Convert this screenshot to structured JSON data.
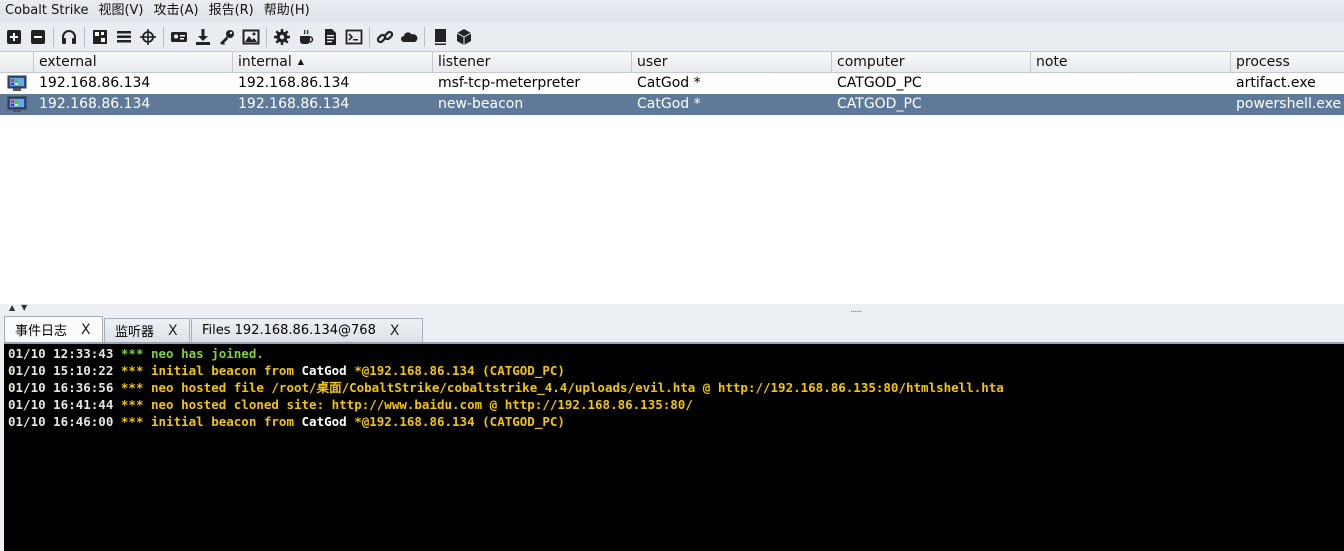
{
  "menu": {
    "items": [
      "Cobalt Strike",
      "视图(V)",
      "攻击(A)",
      "报告(R)",
      "帮助(H)"
    ]
  },
  "toolbar": {
    "icons": [
      "new-connection-icon",
      "disconnect-icon",
      "listeners-icon",
      "pivot-graph-icon",
      "session-table-icon",
      "targets-icon",
      "credentials-icon",
      "downloads-icon",
      "keystrokes-icon",
      "screenshots-icon",
      "payload-generator-icon",
      "java-applet-icon",
      "script-console-icon",
      "clone-site-icon",
      "host-file-icon",
      "web-log-icon",
      "help-icon",
      "about-icon"
    ]
  },
  "table": {
    "columns": [
      "external",
      "internal",
      "listener",
      "user",
      "computer",
      "note",
      "process"
    ],
    "sort_column": "internal",
    "rows": [
      {
        "external": "192.168.86.134",
        "internal": "192.168.86.134",
        "listener": "msf-tcp-meterpreter",
        "user": "CatGod *",
        "computer": "CATGOD_PC",
        "note": "",
        "process": "artifact.exe",
        "selected": false
      },
      {
        "external": "192.168.86.134",
        "internal": "192.168.86.134",
        "listener": "new-beacon",
        "user": "CatGod *",
        "computer": "CATGOD_PC",
        "note": "",
        "process": "powershell.exe",
        "selected": true
      }
    ]
  },
  "tabs": [
    {
      "label": "事件日志",
      "close": "X",
      "active": true
    },
    {
      "label": "监听器",
      "close": "X",
      "active": false
    },
    {
      "label": "Files 192.168.86.134@768",
      "close": "X",
      "active": false
    }
  ],
  "console": {
    "lines": [
      {
        "ts": "01/10 12:33:43",
        "stars": "***",
        "parts": [
          {
            "t": "neo has joined.",
            "c": "green"
          }
        ]
      },
      {
        "ts": "01/10 15:10:22",
        "stars": "***",
        "parts": [
          {
            "t": "initial beacon from ",
            "c": "yellow"
          },
          {
            "t": "CatGod *@192.168.86.134 (CATGOD_PC)",
            "c": "yellow"
          }
        ]
      },
      {
        "ts": "01/10 16:36:56",
        "stars": "***",
        "parts": [
          {
            "t": "neo hosted file /root/桌面/CobaltStrike/cobaltstrike_4.4/uploads/evil.hta @ http://192.168.86.135:80/htmlshell.hta",
            "c": "yellow"
          }
        ]
      },
      {
        "ts": "01/10 16:41:44",
        "stars": "***",
        "parts": [
          {
            "t": "neo hosted cloned site: http://www.baidu.com @ http://192.168.86.135:80/",
            "c": "yellow"
          }
        ]
      },
      {
        "ts": "01/10 16:46:00",
        "stars": "***",
        "parts": [
          {
            "t": "initial beacon from ",
            "c": "yellow"
          },
          {
            "t": "CatGod *@192.168.86.134 (CATGOD_PC)",
            "c": "yellow"
          }
        ]
      }
    ]
  },
  "colors": {
    "selected_row": "#5f7a99",
    "console_bg": "#000000",
    "console_green": "#7fd138",
    "console_yellow": "#f2c40b"
  }
}
